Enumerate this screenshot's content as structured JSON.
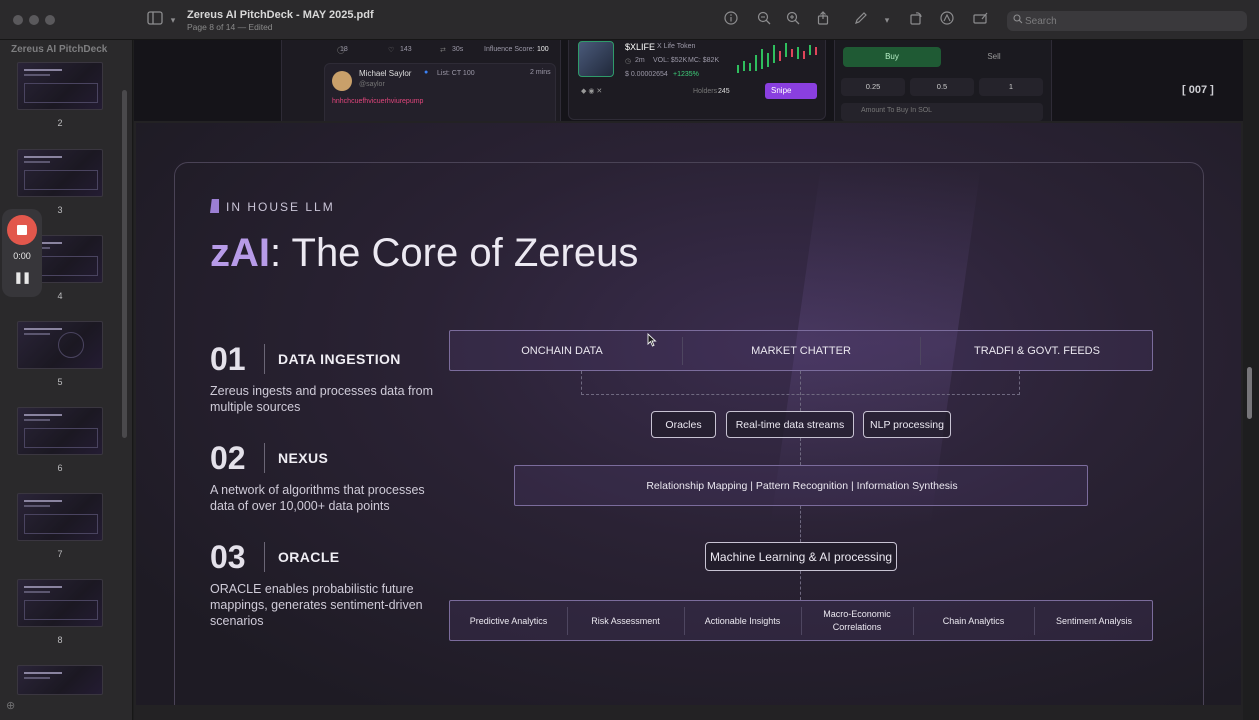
{
  "window": {
    "title": "Zereus AI PitchDeck - MAY 2025.pdf",
    "subtitle": "Page 8 of 14 — Edited"
  },
  "toolbar": {
    "search_placeholder": "Search"
  },
  "sidebar": {
    "doc_title": "Zereus AI PitchDeck",
    "pages": [
      "2",
      "3",
      "4",
      "5",
      "6",
      "7",
      "8"
    ]
  },
  "recorder": {
    "time": "0:00"
  },
  "prev_page": {
    "post_stats": {
      "comments": "18",
      "likes": "143",
      "reposts": "30s",
      "influence_label": "Influence Score:",
      "influence_value": "100"
    },
    "post_author": "Michael Saylor",
    "post_list": "List: CT 100",
    "post_handle": "@saylor",
    "post_time": "2 mins",
    "post_body": "hnhchcuefhvicuerhviurepump",
    "token_symbol": "$XLIFE",
    "token_name": "X Life Token",
    "token_age": "2m",
    "token_vol": "VOL: $52K",
    "token_mc": "MC: $82K",
    "token_price": "$ 0.00002654",
    "token_change": "+1235%",
    "holders_label": "Holders",
    "holders_value": "245",
    "snipe_label": "Snipe",
    "buy_label": "Buy",
    "sell_label": "Sell",
    "amounts": [
      "0.25",
      "0.5",
      "1"
    ],
    "amount_placeholder": "Amount To Buy In SOL",
    "page_marker": "[ 007 ]"
  },
  "slide": {
    "eyebrow": "IN HOUSE LLM",
    "headline_highlight": "zAI",
    "headline_rest": ": The Core of Zereus",
    "steps": [
      {
        "num": "01",
        "title": "DATA INGESTION",
        "desc": "Zereus ingests and processes data from multiple sources"
      },
      {
        "num": "02",
        "title": "NEXUS",
        "desc": "A network of algorithms that processes data of over 10,000+ data points"
      },
      {
        "num": "03",
        "title": "ORACLE",
        "desc": "ORACLE enables probabilistic future mappings, generates sentiment-driven scenarios"
      }
    ],
    "sources": [
      "ONCHAIN DATA",
      "MARKET CHATTER",
      "TRADFI & GOVT. FEEDS"
    ],
    "processing_chips": [
      "Oracles",
      "Real-time data streams",
      "NLP processing"
    ],
    "nexus_bar": "Relationship Mapping | Pattern Recognition | Information Synthesis",
    "ml_chip": "Machine Learning & AI processing",
    "outputs": [
      "Predictive Analytics",
      "Risk Assessment",
      "Actionable Insights",
      "Macro-Economic Correlations",
      "Chain Analytics",
      "Sentiment Analysis"
    ]
  }
}
